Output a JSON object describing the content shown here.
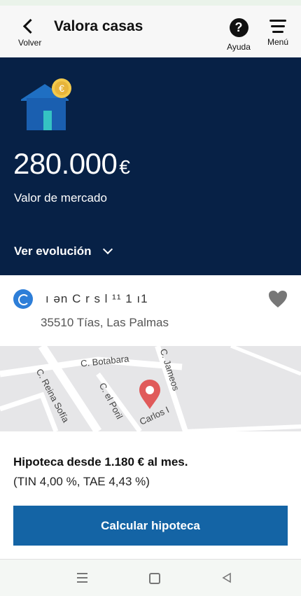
{
  "header": {
    "back_label": "Volver",
    "title": "Valora casas",
    "help_label": "Ayuda",
    "menu_label": "Menú"
  },
  "hero": {
    "price": "280.000",
    "currency": "€",
    "subtitle": "Valor de mercado",
    "evolution_label": "Ver evolución",
    "background_color": "#072146"
  },
  "property": {
    "street": "ı ən C r s l ¹¹ 1 ı1",
    "city": "35510 Tías, Las Palmas"
  },
  "map": {
    "streets": [
      "C. Reina Sofía",
      "C. Botabara",
      "C. el Poril",
      "C. Jameos",
      "Carlos I"
    ]
  },
  "mortgage": {
    "line1": "Hipoteca desde 1.180 € al mes.",
    "line2": "(TIN 4,00 %, TAE 4,43 %)",
    "button_label": "Calcular hipoteca",
    "button_color": "#1464a5"
  },
  "icons": [
    "back-chevron-icon",
    "help-icon",
    "hamburger-menu-icon",
    "house-coin-icon",
    "chevron-down-icon",
    "bank-logo-icon",
    "heart-icon",
    "map-pin-icon"
  ]
}
